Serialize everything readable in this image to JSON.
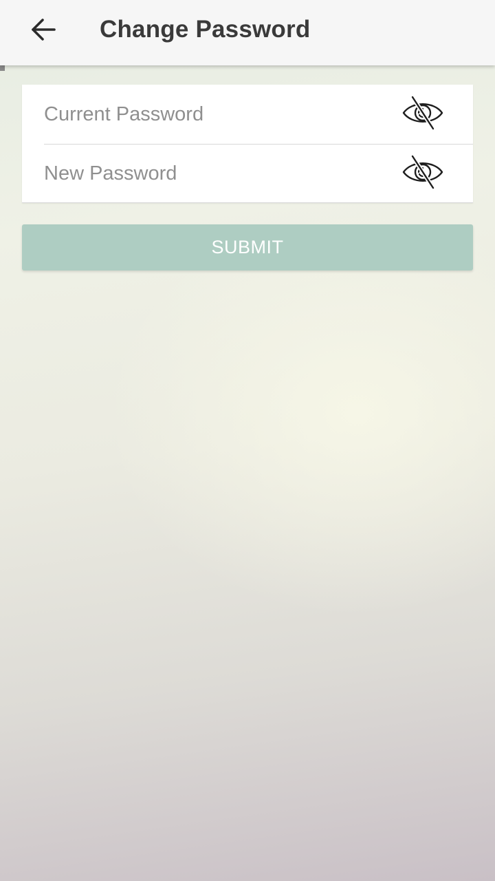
{
  "header": {
    "title": "Change Password",
    "back_icon": "arrow-left-icon"
  },
  "form": {
    "current_password": {
      "placeholder": "Current Password",
      "value": "",
      "toggle_icon": "eye-off-icon"
    },
    "new_password": {
      "placeholder": "New Password",
      "value": "",
      "toggle_icon": "eye-off-icon"
    },
    "submit_label": "SUBMIT"
  },
  "colors": {
    "app_bar": "#f6f6f6",
    "title_text": "#3a3a3a",
    "submit_button": "#aecdc2",
    "submit_text": "#ffffff",
    "placeholder_text": "#8f8f8f"
  }
}
